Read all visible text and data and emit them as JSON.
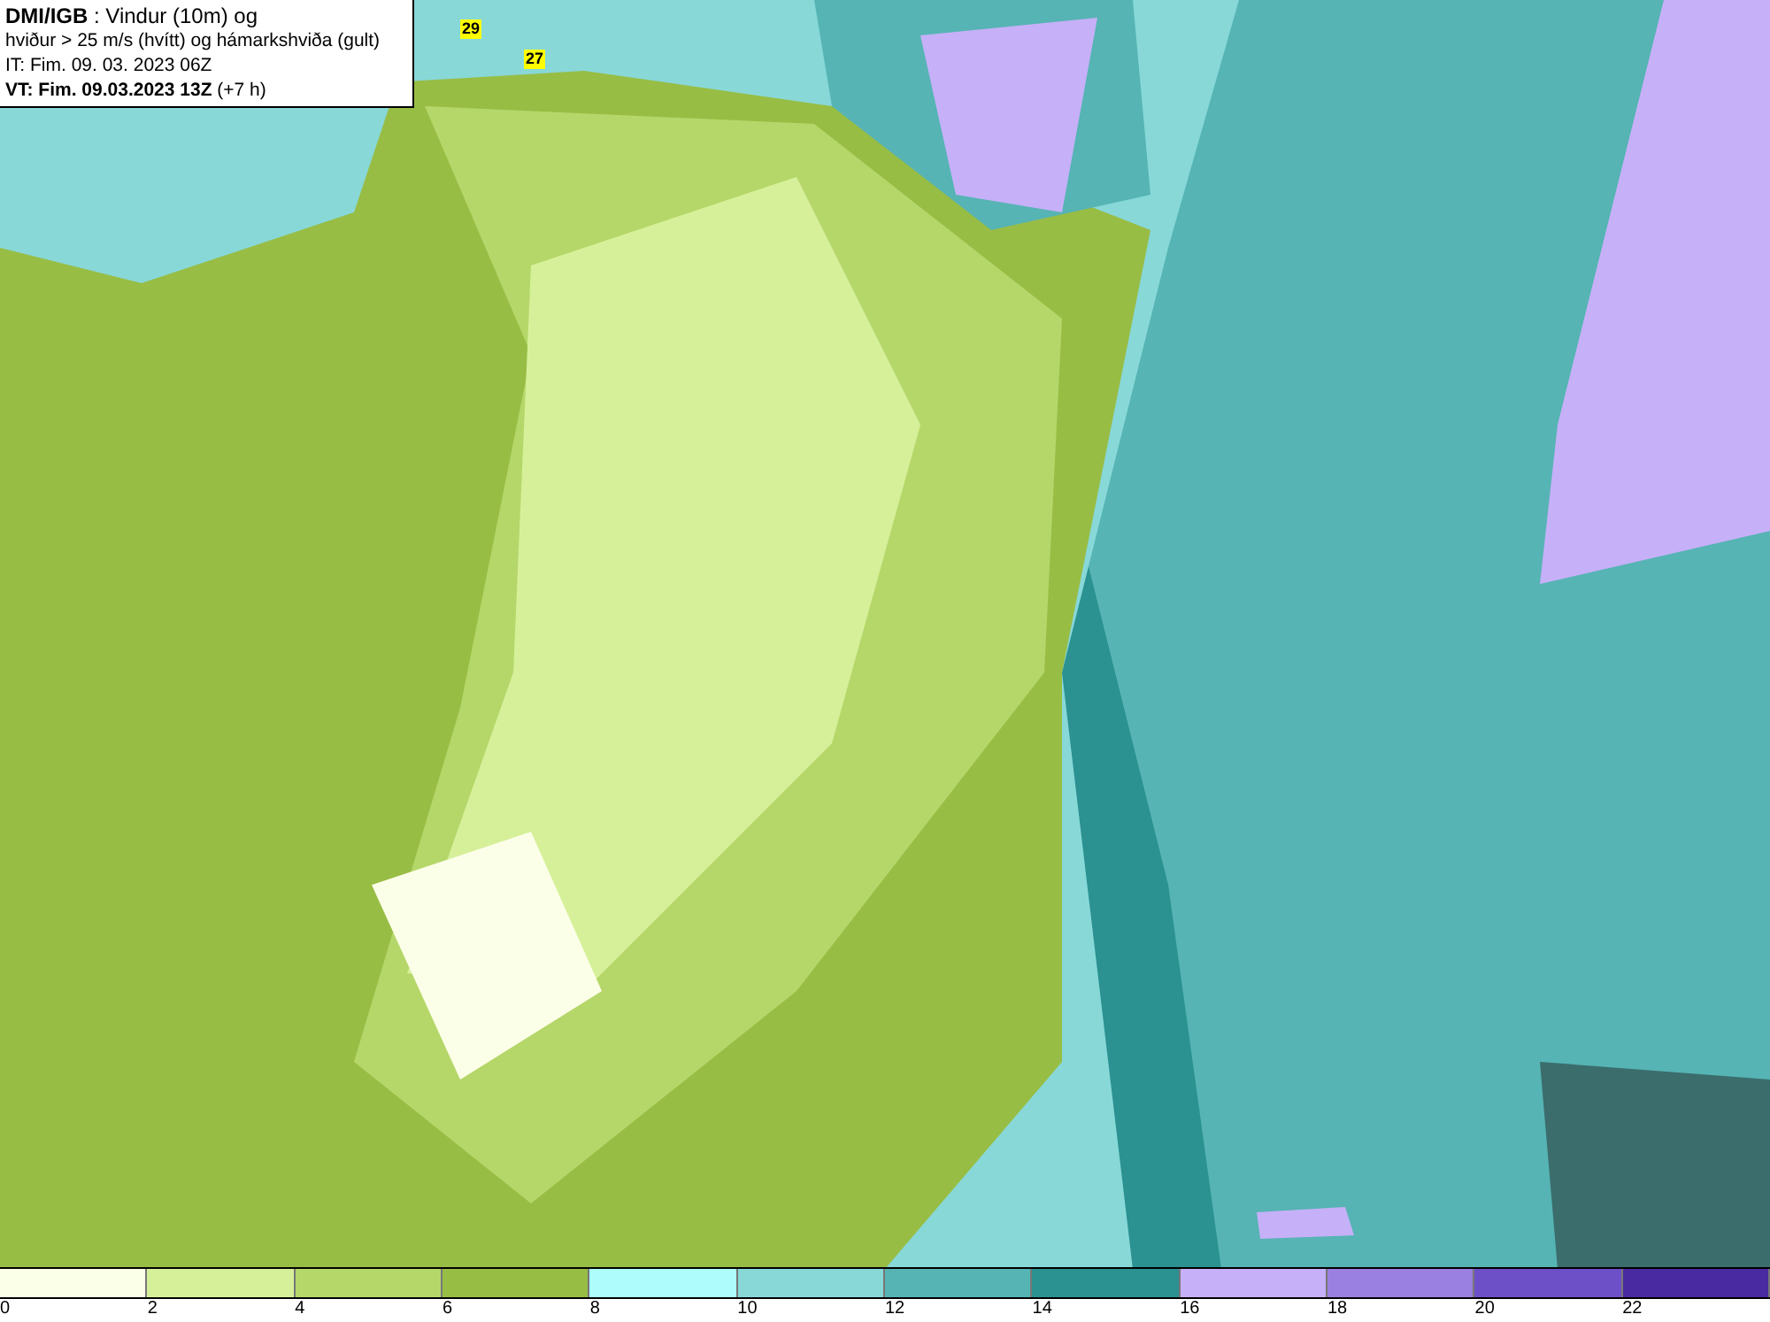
{
  "header": {
    "lines": [
      "**DMI/IGB** : Vindur (10m) og",
      "hviður > 25 m/s (hvítt) og hámarkshviða (gult)",
      "IT: Fim. 09. 03. 2023 06Z",
      "**VT: Fim. 09.03.2023 13Z** (+7 h)"
    ]
  },
  "map": {
    "gust_labels": [
      "29",
      "27"
    ]
  },
  "legend": [
    {
      "label": "0",
      "color": "#fcffe8"
    },
    {
      "label": "2",
      "color": "#d6f09a"
    },
    {
      "label": "4",
      "color": "#b5d76a"
    },
    {
      "label": "6",
      "color": "#98bd45"
    },
    {
      "label": "8",
      "color": "#aefcfc"
    },
    {
      "label": "10",
      "color": "#88d8d8"
    },
    {
      "label": "12",
      "color": "#56b4b4"
    },
    {
      "label": "14",
      "color": "#2b9191"
    },
    {
      "label": "16",
      "color": "#c6b0f8"
    },
    {
      "label": "18",
      "color": "#9a80e0"
    },
    {
      "label": "20",
      "color": "#6d50c8"
    },
    {
      "label": "22",
      "color": "#4a2aa0"
    }
  ]
}
